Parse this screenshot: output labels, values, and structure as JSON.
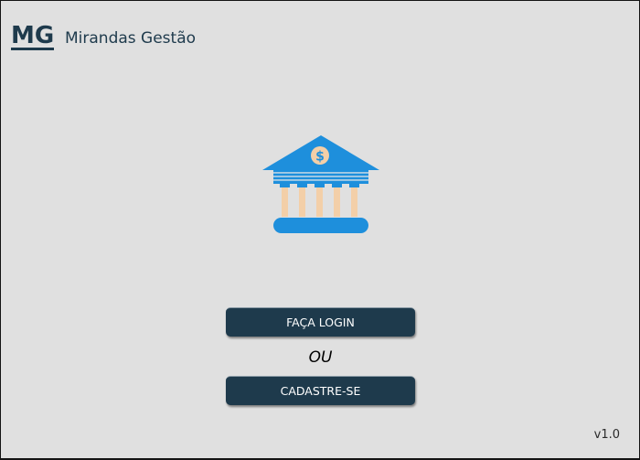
{
  "header": {
    "logo_text": "MG",
    "app_name": "Mirandas Gestão"
  },
  "hero": {
    "icon": "bank-icon",
    "coin_symbol": "$"
  },
  "actions": {
    "login_label": "FAÇA LOGIN",
    "separator": "OU",
    "register_label": "CADASTRE-SE"
  },
  "footer": {
    "version": "v1.0"
  },
  "colors": {
    "background": "#e0e0e0",
    "primary": "#1e3a4c",
    "icon_blue": "#1e8fdc",
    "column": "#f3cfa8",
    "coin": "#f3cfa8"
  }
}
